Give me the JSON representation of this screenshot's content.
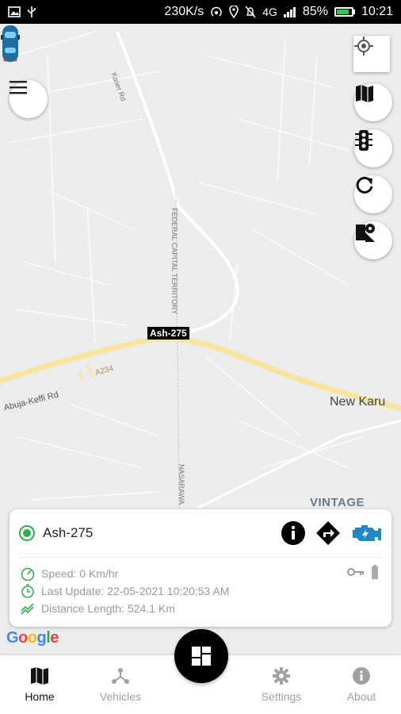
{
  "status_bar": {
    "speed": "230K/s",
    "network": "4G",
    "battery_percent": "85%",
    "battery_level": 0.85,
    "time": "10:21",
    "icons": [
      "image-icon",
      "usb-icon",
      "hotspot-icon",
      "location-icon",
      "mute-icon",
      "signal-icon",
      "battery-icon"
    ]
  },
  "map": {
    "road_labels": {
      "kaser": "Kaser Rd",
      "fct": "FEDERAL CAPITAL TERRITORY",
      "nasarawa": "NASARAWA",
      "abuja_keffi": "Abuja-Keffi Rd",
      "a234": "A234"
    },
    "place_labels": {
      "new_karu": "New Karu",
      "vintage": "VINTAGE"
    },
    "vehicle_tag": "Ash-275",
    "attribution": "Google",
    "controls": [
      "my-location-icon",
      "map-layers-icon",
      "traffic-light-icon",
      "refresh-icon",
      "satellite-icon"
    ]
  },
  "card": {
    "vehicle_name": "Ash-275",
    "speed": "Speed: 0 Km/hr",
    "last_update": "Last Update: 22-05-2021 10:20:53 AM",
    "distance": "Distance Length: 524.1 Km",
    "status_color": "#2bb34a",
    "engine_color": "#1e88c8"
  },
  "nav": {
    "home": "Home",
    "vehicles": "Vehicles",
    "settings": "Settings",
    "about": "About"
  },
  "colors": {
    "accent_green": "#2bb34a",
    "road_yellow": "#f6e59a"
  }
}
